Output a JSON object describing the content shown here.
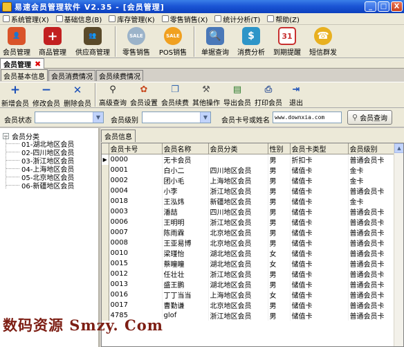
{
  "window": {
    "title": "易速会员管理软件 V2.35 - [会员管理]",
    "controls": [
      "_",
      "□",
      "X"
    ]
  },
  "menubar": {
    "items": [
      "系统管理(X)",
      "基础信息(B)",
      "库存管理(K)",
      "零售销售(X)",
      "统计分析(T)",
      "帮助(Z)"
    ]
  },
  "main_toolbar": {
    "buttons": [
      {
        "label": "会员管理",
        "icon": "member-icon",
        "color": "#d9542a"
      },
      {
        "label": "商品管理",
        "icon": "product-add-icon",
        "color": "#c22020"
      },
      {
        "label": "供应商管理",
        "icon": "supplier-icon",
        "color": "#5a4a2a"
      },
      {
        "label": "零售销售",
        "icon": "sale-icon",
        "color": "#9bb3c9"
      },
      {
        "label": "POS销售",
        "icon": "pos-sale-icon",
        "color": "#f0a020"
      },
      {
        "label": "单据查询",
        "icon": "document-search-icon",
        "color": "#4a78b8"
      },
      {
        "label": "消费分析",
        "icon": "consumption-analysis-icon",
        "color": "#2d95c8"
      },
      {
        "label": "到期提醒",
        "icon": "calendar-icon",
        "color": "#c83030"
      },
      {
        "label": "短信群发",
        "icon": "sms-icon",
        "color": "#e8b020"
      }
    ],
    "icon_glyphs": [
      "👤",
      "+",
      "👥",
      "SALE",
      "SALE",
      "🔍",
      "$",
      "31",
      "☎"
    ]
  },
  "doc_tab": {
    "label": "会员管理",
    "close": "✖"
  },
  "subtabs": [
    {
      "label": "会员基本信息",
      "active": true
    },
    {
      "label": "会员消费情况",
      "active": false
    },
    {
      "label": "会员续费情况",
      "active": false
    }
  ],
  "action_toolbar": {
    "buttons": [
      {
        "label": "新增会员",
        "icon": "plus-icon",
        "glyph": "+",
        "color": "#1a4fb8"
      },
      {
        "label": "修改会员",
        "icon": "minus-icon",
        "glyph": "−",
        "color": "#1a4fb8"
      },
      {
        "label": "删除会员",
        "icon": "delete-icon",
        "glyph": "✕",
        "color": "#1a4fb8"
      },
      {
        "label": "高级查询",
        "icon": "binoculars-icon",
        "glyph": "⚲",
        "color": "#222"
      },
      {
        "label": "会员设置",
        "icon": "settings-icon",
        "glyph": "✿",
        "color": "#c84a20"
      },
      {
        "label": "会员续费",
        "icon": "renew-icon",
        "glyph": "❐",
        "color": "#3a6ab0"
      },
      {
        "label": "其他操作",
        "icon": "tools-icon",
        "glyph": "⚒",
        "color": "#555"
      },
      {
        "label": "导出会员",
        "icon": "export-icon",
        "glyph": "▤",
        "color": "#2a7a2a"
      },
      {
        "label": "打印会员",
        "icon": "print-icon",
        "glyph": "⎙",
        "color": "#3a5a9a"
      },
      {
        "label": "退出",
        "icon": "exit-icon",
        "glyph": "⇥",
        "color": "#1a4fb8"
      }
    ]
  },
  "filter": {
    "status_label": "会员状态",
    "status_value": "",
    "level_label": "会员级别",
    "level_value": "",
    "search_label": "会员卡号或姓名",
    "search_value": "www.downxia.com",
    "search_button": "会员查询"
  },
  "tree": {
    "root": "会员分类",
    "root_expander": "−",
    "items": [
      "01-湖北地区会员",
      "02-四川地区会员",
      "03-浙江地区会员",
      "04-上海地区会员",
      "05-北京地区会员",
      "06-新疆地区会员"
    ]
  },
  "grid": {
    "tab_label": "会员信息",
    "columns": [
      "会员卡号",
      "会员名称",
      "会员分类",
      "性别",
      "会员卡类型",
      "会员级别"
    ],
    "current_row_marker": "▶",
    "rows": [
      [
        "0000",
        "无卡会员",
        "",
        "男",
        "折扣卡",
        "普通会员卡"
      ],
      [
        "0001",
        "白小二",
        "四川地区会员",
        "男",
        "储值卡",
        "金卡"
      ],
      [
        "0002",
        "团小毛",
        "上海地区会员",
        "男",
        "储值卡",
        "金卡"
      ],
      [
        "0004",
        "小李",
        "浙江地区会员",
        "男",
        "储值卡",
        "普通会员卡"
      ],
      [
        "0018",
        "王泓炜",
        "新疆地区会员",
        "男",
        "储值卡",
        "金卡"
      ],
      [
        "0003",
        "潘喆",
        "四川地区会员",
        "男",
        "储值卡",
        "普通会员卡"
      ],
      [
        "0006",
        "王明明",
        "浙江地区会员",
        "男",
        "储值卡",
        "普通会员卡"
      ],
      [
        "0007",
        "陈雨霖",
        "北京地区会员",
        "男",
        "储值卡",
        "普通会员卡"
      ],
      [
        "0008",
        "王亚易博",
        "北京地区会员",
        "男",
        "储值卡",
        "普通会员卡"
      ],
      [
        "0010",
        "梁瑾怡",
        "湖北地区会员",
        "女",
        "储值卡",
        "普通会员卡"
      ],
      [
        "0015",
        "蔡瞳瞳",
        "湖北地区会员",
        "女",
        "储值卡",
        "普通会员卡"
      ],
      [
        "0012",
        "任壮壮",
        "浙江地区会员",
        "男",
        "储值卡",
        "普通会员卡"
      ],
      [
        "0013",
        "盛王鹏",
        "湖北地区会员",
        "男",
        "储值卡",
        "普通会员卡"
      ],
      [
        "0016",
        "丁丁当当",
        "上海地区会员",
        "女",
        "储值卡",
        "普通会员卡"
      ],
      [
        "0017",
        "曹勤谦",
        "北京地区会员",
        "男",
        "储值卡",
        "普通会员卡"
      ],
      [
        "4785",
        "glof",
        "浙江地区会员",
        "男",
        "储值卡",
        "普通会员卡"
      ]
    ]
  },
  "watermark": "数码资源 Smzy. Com"
}
